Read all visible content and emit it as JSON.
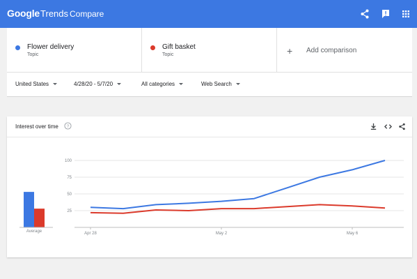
{
  "header": {
    "logo_google": "Google",
    "logo_trends": "Trends",
    "title": "Compare",
    "icons": [
      "share-icon",
      "feedback-icon",
      "apps-grid-icon"
    ]
  },
  "terms": [
    {
      "name": "Flower delivery",
      "type": "Topic",
      "color": "#3c78e2"
    },
    {
      "name": "Gift basket",
      "type": "Topic",
      "color": "#db3a2b"
    }
  ],
  "add_comparison": {
    "icon": "+",
    "label": "Add comparison"
  },
  "filters": {
    "region": "United States",
    "date_range": "4/28/20 - 5/7/20",
    "category": "All categories",
    "search_type": "Web Search"
  },
  "card": {
    "title": "Interest over time",
    "icons": [
      "help-icon",
      "download-icon",
      "embed-icon",
      "share-icon"
    ]
  },
  "chart_data": {
    "type": "line",
    "x": [
      "Apr 28",
      "Apr 29",
      "Apr 30",
      "May 1",
      "May 2",
      "May 3",
      "May 4",
      "May 5",
      "May 6",
      "May 7"
    ],
    "x_tick_labels": [
      "Apr 28",
      "May 2",
      "May 6"
    ],
    "y_ticks": [
      25,
      50,
      75,
      100
    ],
    "ylim": [
      0,
      100
    ],
    "grid": true,
    "series": [
      {
        "name": "Flower delivery",
        "color": "#3c78e2",
        "values": [
          30,
          28,
          34,
          36,
          39,
          43,
          59,
          75,
          86,
          100
        ],
        "average": 53
      },
      {
        "name": "Gift basket",
        "color": "#db3a2b",
        "values": [
          22,
          21,
          26,
          25,
          28,
          28,
          31,
          34,
          32,
          29
        ],
        "average": 28
      }
    ],
    "average_label": "Average"
  }
}
